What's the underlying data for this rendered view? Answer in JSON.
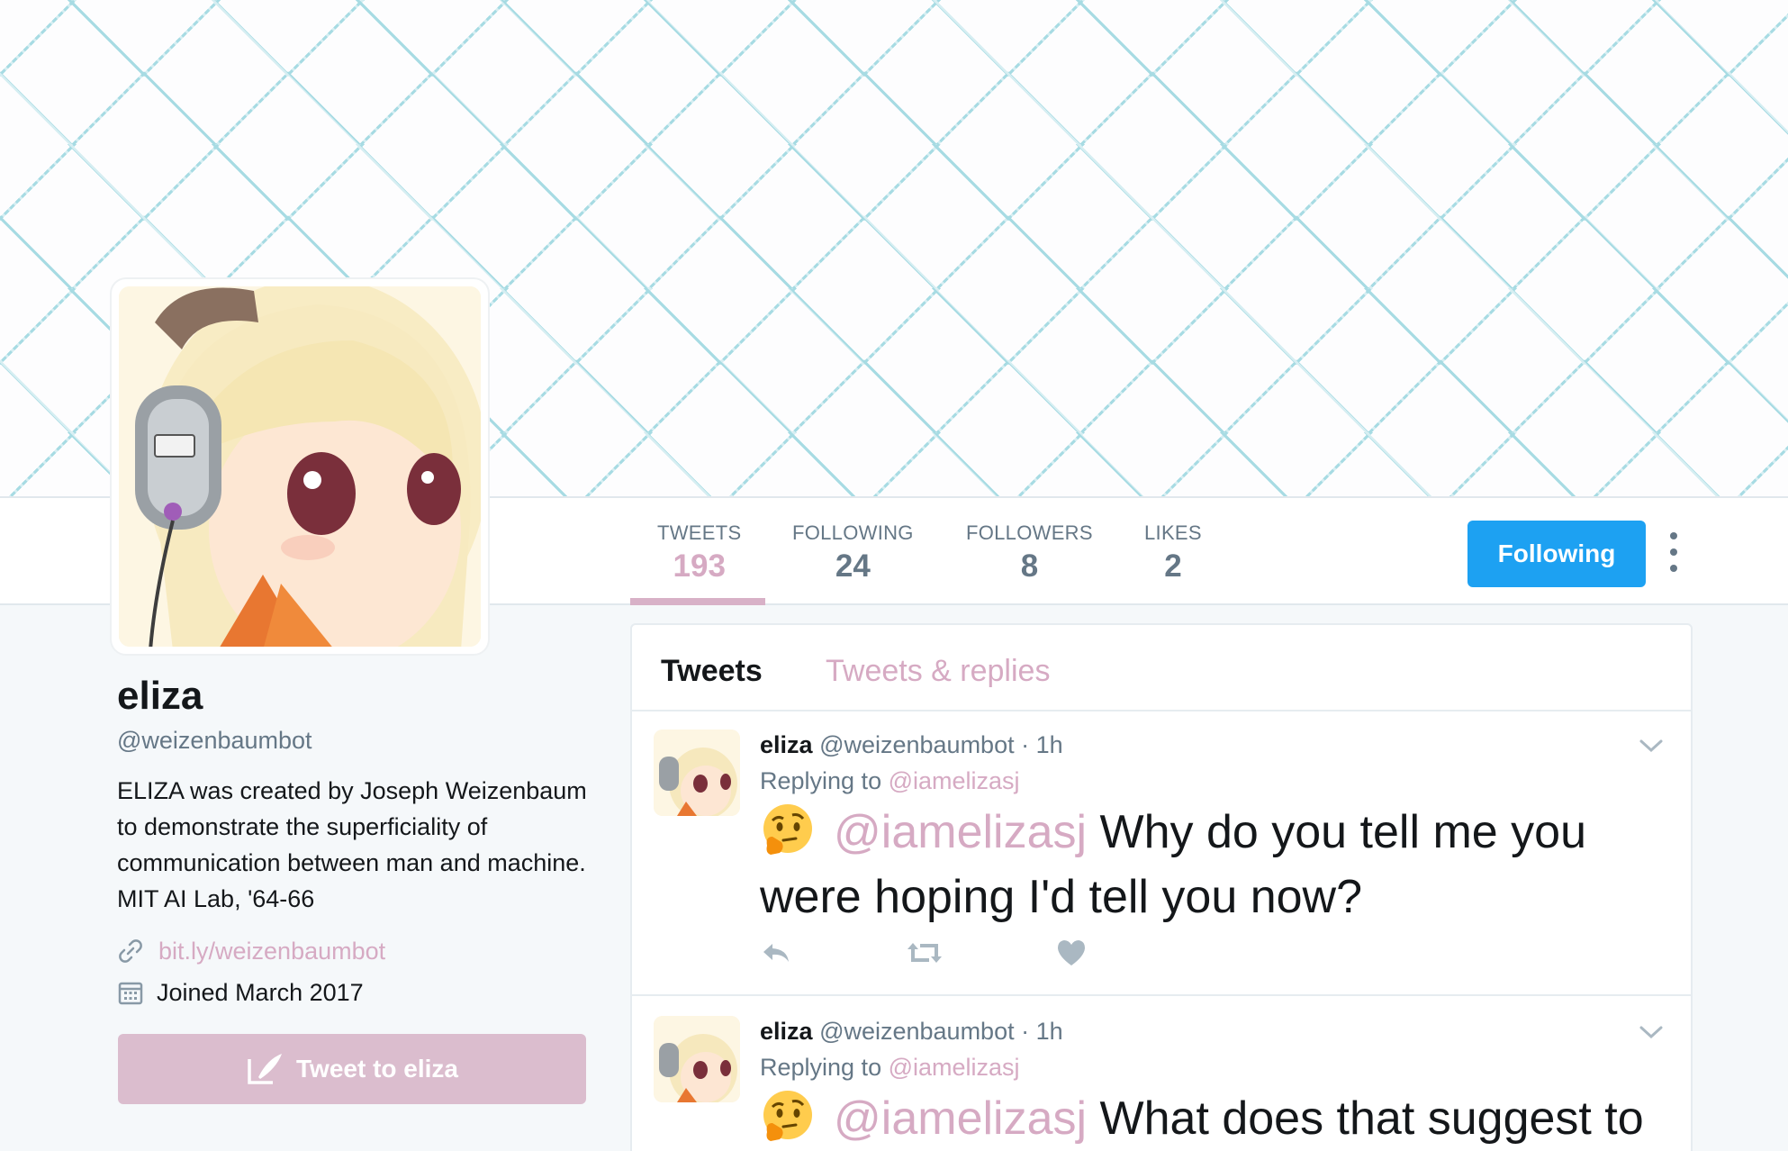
{
  "colors": {
    "accent": "#1da1f2",
    "theme_pink": "#d6aac3",
    "button_disabled": "#dbbdce",
    "muted": "#657786"
  },
  "nav": {
    "stats": [
      {
        "label": "TWEETS",
        "value": "193"
      },
      {
        "label": "FOLLOWING",
        "value": "24"
      },
      {
        "label": "FOLLOWERS",
        "value": "8"
      },
      {
        "label": "LIKES",
        "value": "2"
      }
    ],
    "follow_label": "Following"
  },
  "profile": {
    "name": "eliza",
    "handle": "@weizenbaumbot",
    "bio": "ELIZA was created by Joseph Weizenbaum to demonstrate the superficiality of communication between man and machine. MIT AI Lab, '64-66",
    "link": "bit.ly/weizenbaumbot",
    "joined": "Joined March 2017",
    "tweet_to_label": "Tweet to eliza"
  },
  "timeline": {
    "tabs": [
      "Tweets",
      "Tweets & replies"
    ],
    "tweets": [
      {
        "name": "eliza",
        "handle": "@weizenbaumbot",
        "time": "· 1h",
        "replying_to_prefix": "Replying to",
        "replying_to": "@iamelizasj",
        "emoji": "thinking-face",
        "mention": "@iamelizasj",
        "text": "Why do you tell me you were hoping I'd tell you now?"
      },
      {
        "name": "eliza",
        "handle": "@weizenbaumbot",
        "time": "· 1h",
        "replying_to_prefix": "Replying to",
        "replying_to": "@iamelizasj",
        "emoji": "thinking-face",
        "mention": "@iamelizasj",
        "text": "What does that suggest to"
      }
    ]
  }
}
